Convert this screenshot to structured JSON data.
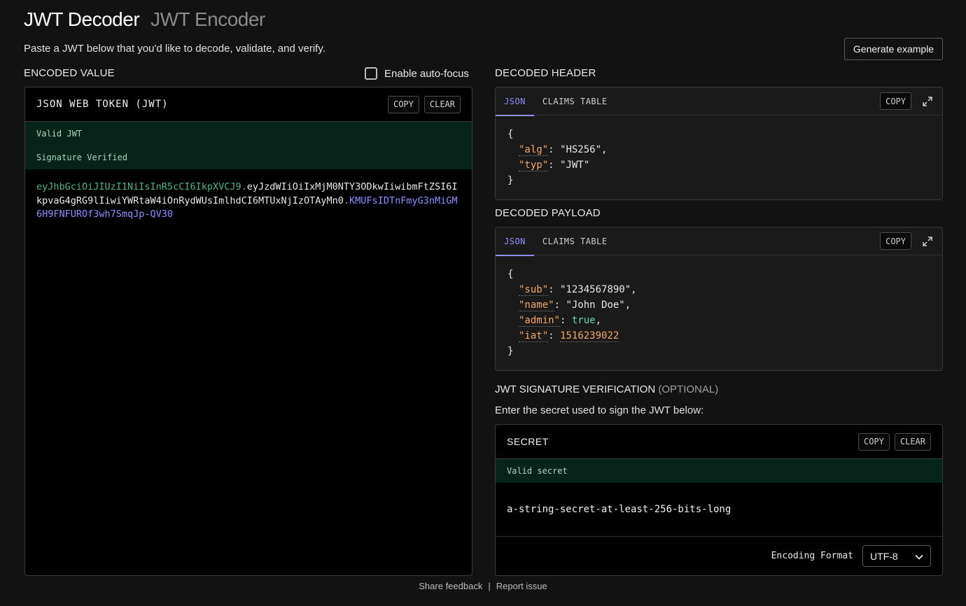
{
  "header": {
    "title_active": "JWT Decoder",
    "title_inactive": "JWT Encoder",
    "subtitle": "Paste a JWT below that you'd like to decode, validate, and verify.",
    "generate_label": "Generate example"
  },
  "encoded": {
    "section_label": "ENCODED VALUE",
    "autofocus_label": "Enable auto-focus",
    "autofocus_checked": false,
    "panel_title": "JSON WEB TOKEN (JWT)",
    "copy_label": "COPY",
    "clear_label": "CLEAR",
    "status_valid": "Valid JWT",
    "status_signature": "Signature Verified",
    "token_header": "eyJhbGciOiJIUzI1NiIsInR5cCI6IkpXVCJ9",
    "token_dot1": ".",
    "token_payload": "eyJzdWIiOiIxMjM0NTY3ODkwIiwibmFtZSI6IkpvaG4gRG9lIiwiYWRtaW4iOnRydWUsImlhdCI6MTUxNjIzOTAyMn0",
    "token_dot2": ".",
    "token_signature": "KMUFsIDTnFmyG3nMiGM6H9FNFUROf3wh7SmqJp-QV30"
  },
  "decoded_header": {
    "section_label": "DECODED HEADER",
    "tab_json": "JSON",
    "tab_claims": "CLAIMS TABLE",
    "copy_label": "COPY",
    "open_brace": "{",
    "close_brace": "}",
    "fields": [
      {
        "key": "\"alg\"",
        "value": "\"HS256\"",
        "comma": ","
      },
      {
        "key": "\"typ\"",
        "value": "\"JWT\"",
        "comma": ""
      }
    ]
  },
  "decoded_payload": {
    "section_label": "DECODED PAYLOAD",
    "tab_json": "JSON",
    "tab_claims": "CLAIMS TABLE",
    "copy_label": "COPY",
    "open_brace": "{",
    "close_brace": "}",
    "fields": [
      {
        "key": "\"sub\"",
        "value": "\"1234567890\"",
        "comma": ","
      },
      {
        "key": "\"name\"",
        "value": "\"John Doe\"",
        "comma": ","
      },
      {
        "key": "\"admin\"",
        "value": "true",
        "comma": ","
      },
      {
        "key": "\"iat\"",
        "value": "1516239022",
        "comma": ""
      }
    ]
  },
  "signature": {
    "label": "JWT SIGNATURE VERIFICATION",
    "optional": "(OPTIONAL)",
    "description": "Enter the secret used to sign the JWT below:",
    "panel_title": "SECRET",
    "copy_label": "COPY",
    "clear_label": "CLEAR",
    "status": "Valid secret",
    "secret_value": "a-string-secret-at-least-256-bits-long",
    "encoding_label": "Encoding Format",
    "encoding_value": "UTF-8"
  },
  "footer": {
    "feedback": "Share feedback",
    "separator": "|",
    "report": "Report issue"
  },
  "colors": {
    "background": "#121212",
    "valid_bar": "#06241a",
    "token_header": "#4fb58a",
    "token_dot": "#ff6fa8",
    "token_signature": "#8f8fff",
    "json_key": "#f0a86c",
    "json_bool": "#6cd6b0"
  }
}
